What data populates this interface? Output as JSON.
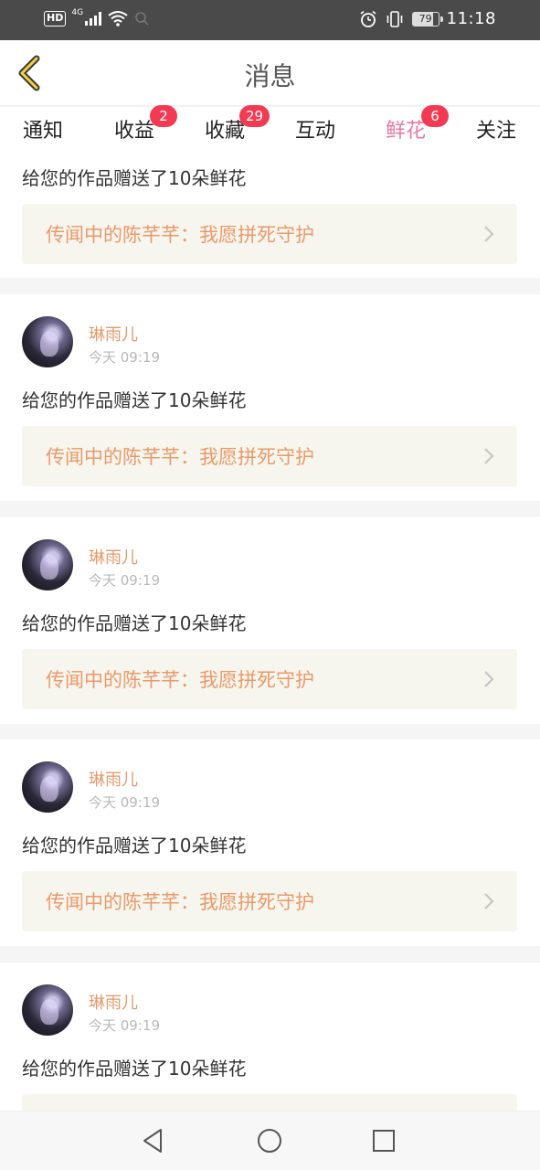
{
  "status_bar": {
    "network_badge": "HD",
    "signal_label": "4G",
    "battery_level": "79",
    "battery_fraction": 0.79,
    "time": "11:18"
  },
  "header": {
    "title": "消息"
  },
  "tabs": [
    {
      "label": "通知",
      "badge": ""
    },
    {
      "label": "收益",
      "badge": "2"
    },
    {
      "label": "收藏",
      "badge": "29"
    },
    {
      "label": "互动",
      "badge": ""
    },
    {
      "label": "鲜花",
      "badge": "6",
      "active": true
    },
    {
      "label": "关注",
      "badge": ""
    }
  ],
  "first_partial": {
    "message": "给您的作品赠送了10朵鲜花",
    "work_title": "传闻中的陈芊芊：我愿拼死守护"
  },
  "items": [
    {
      "username": "琳雨儿",
      "time": "今天 09:19",
      "message": "给您的作品赠送了10朵鲜花",
      "work_title": "传闻中的陈芊芊：我愿拼死守护"
    },
    {
      "username": "琳雨儿",
      "time": "今天 09:19",
      "message": "给您的作品赠送了10朵鲜花",
      "work_title": "传闻中的陈芊芊：我愿拼死守护"
    },
    {
      "username": "琳雨儿",
      "time": "今天 09:19",
      "message": "给您的作品赠送了10朵鲜花",
      "work_title": "传闻中的陈芊芊：我愿拼死守护"
    },
    {
      "username": "琳雨儿",
      "time": "今天 09:19",
      "message": "给您的作品赠送了10朵鲜花",
      "work_title": ""
    }
  ],
  "colors": {
    "accent": "#e878a6",
    "badge": "#f23a52",
    "username": "#e39a6c",
    "work_title": "#ea9a6a",
    "work_bg": "#f6f5ee"
  }
}
